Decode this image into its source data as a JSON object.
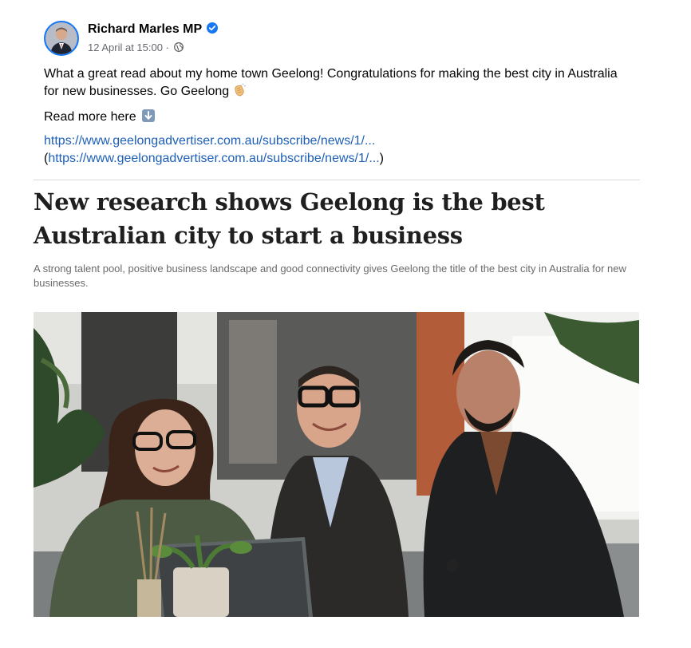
{
  "post": {
    "author": "Richard Marles MP",
    "timestamp": "12 April at 15:00 ·",
    "text": "What a great read about my home town Geelong! Congratulations for making the best city in Australia for new businesses. Go Geelong",
    "read_more": "Read more here",
    "link_1": "https://www.geelongadvertiser.com.au/subscribe/news/1/...",
    "link_2_open": "(",
    "link_2": "https://www.geelongadvertiser.com.au/subscribe/news/1/...",
    "link_2_close": ")",
    "icons": [
      "verified-badge-icon",
      "globe-icon",
      "clapping-hands-icon",
      "down-arrow-icon"
    ]
  },
  "article": {
    "headline": "New research shows Geelong is the best Australian city to start a business",
    "standfirst": "A strong talent pool, positive business landscape and good connectivity gives Geelong the title of the best city in Australia for new businesses.",
    "photo": "three-people-seated-with-laptop-photo"
  },
  "colors": {
    "link": "#1d5fb8",
    "verified": "#1877f2",
    "meta": "#65676b"
  }
}
